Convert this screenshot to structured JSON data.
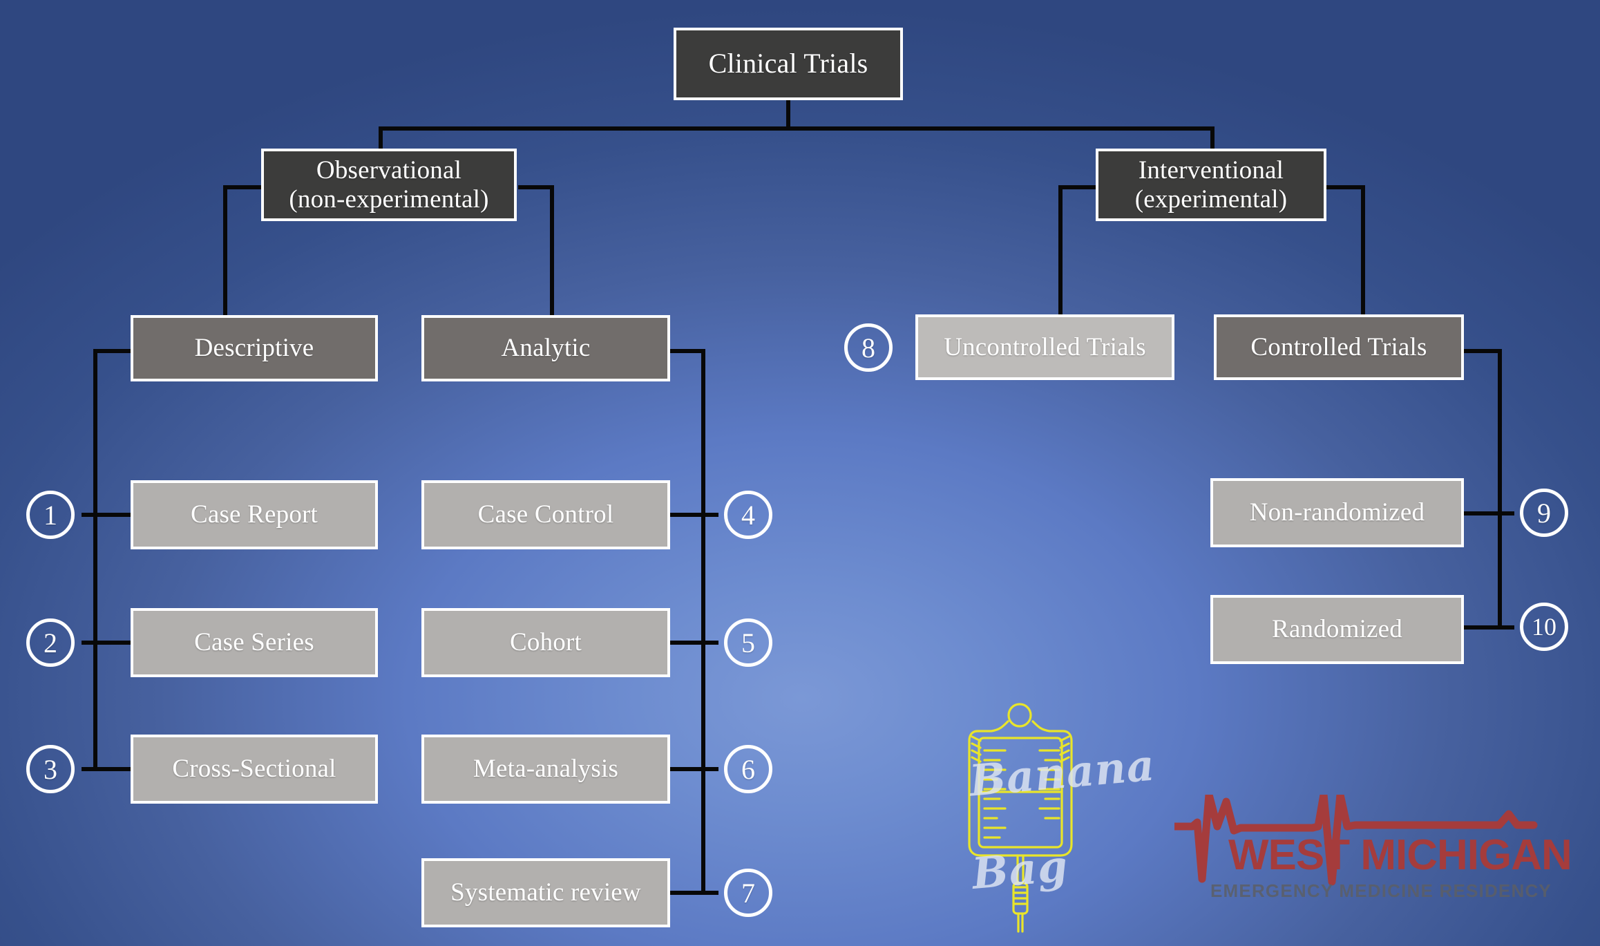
{
  "theme": {
    "background_dark": "#2f4780",
    "background_light": "#7b98d6",
    "node_dark": "#3c3c3b",
    "node_mid": "#716d6b",
    "node_leaf": "#b2b0ae",
    "border": "#ffffff",
    "connector": "#080808",
    "logo_red": "#a53c3c",
    "logo_gray": "#5c5f66",
    "iv_bag_yellow": "#e9e52a"
  },
  "diagram": {
    "type": "hierarchy-tree",
    "root": {
      "label": "Clinical Trials"
    },
    "branches": [
      {
        "id": "observational",
        "label_line1": "Observational",
        "label_line2": "(non-experimental)",
        "children": [
          {
            "id": "descriptive",
            "label": "Descriptive",
            "leaves": [
              {
                "number": "1",
                "label": "Case Report"
              },
              {
                "number": "2",
                "label": "Case Series"
              },
              {
                "number": "3",
                "label": "Cross-Sectional"
              }
            ]
          },
          {
            "id": "analytic",
            "label": "Analytic",
            "leaves": [
              {
                "number": "4",
                "label": "Case Control"
              },
              {
                "number": "5",
                "label": "Cohort"
              },
              {
                "number": "6",
                "label": "Meta-analysis"
              },
              {
                "number": "7",
                "label": "Systematic review"
              }
            ]
          }
        ]
      },
      {
        "id": "interventional",
        "label_line1": "Interventional",
        "label_line2": "(experimental)",
        "children": [
          {
            "id": "uncontrolled",
            "label": "Uncontrolled Trials",
            "number": "8",
            "leaves": []
          },
          {
            "id": "controlled",
            "label": "Controlled Trials",
            "leaves": [
              {
                "number": "9",
                "label": "Non-randomized"
              },
              {
                "number": "10",
                "label": "Randomized"
              }
            ]
          }
        ]
      }
    ]
  },
  "watermarks": {
    "banana": {
      "word1": "Banana",
      "word2": "Bag",
      "icon": "iv-bag-icon"
    },
    "residency": {
      "title": "WEST MICHIGAN",
      "subtitle": "EMERGENCY MEDICINE RESIDENCY",
      "icon": "ekg-line-icon"
    }
  }
}
